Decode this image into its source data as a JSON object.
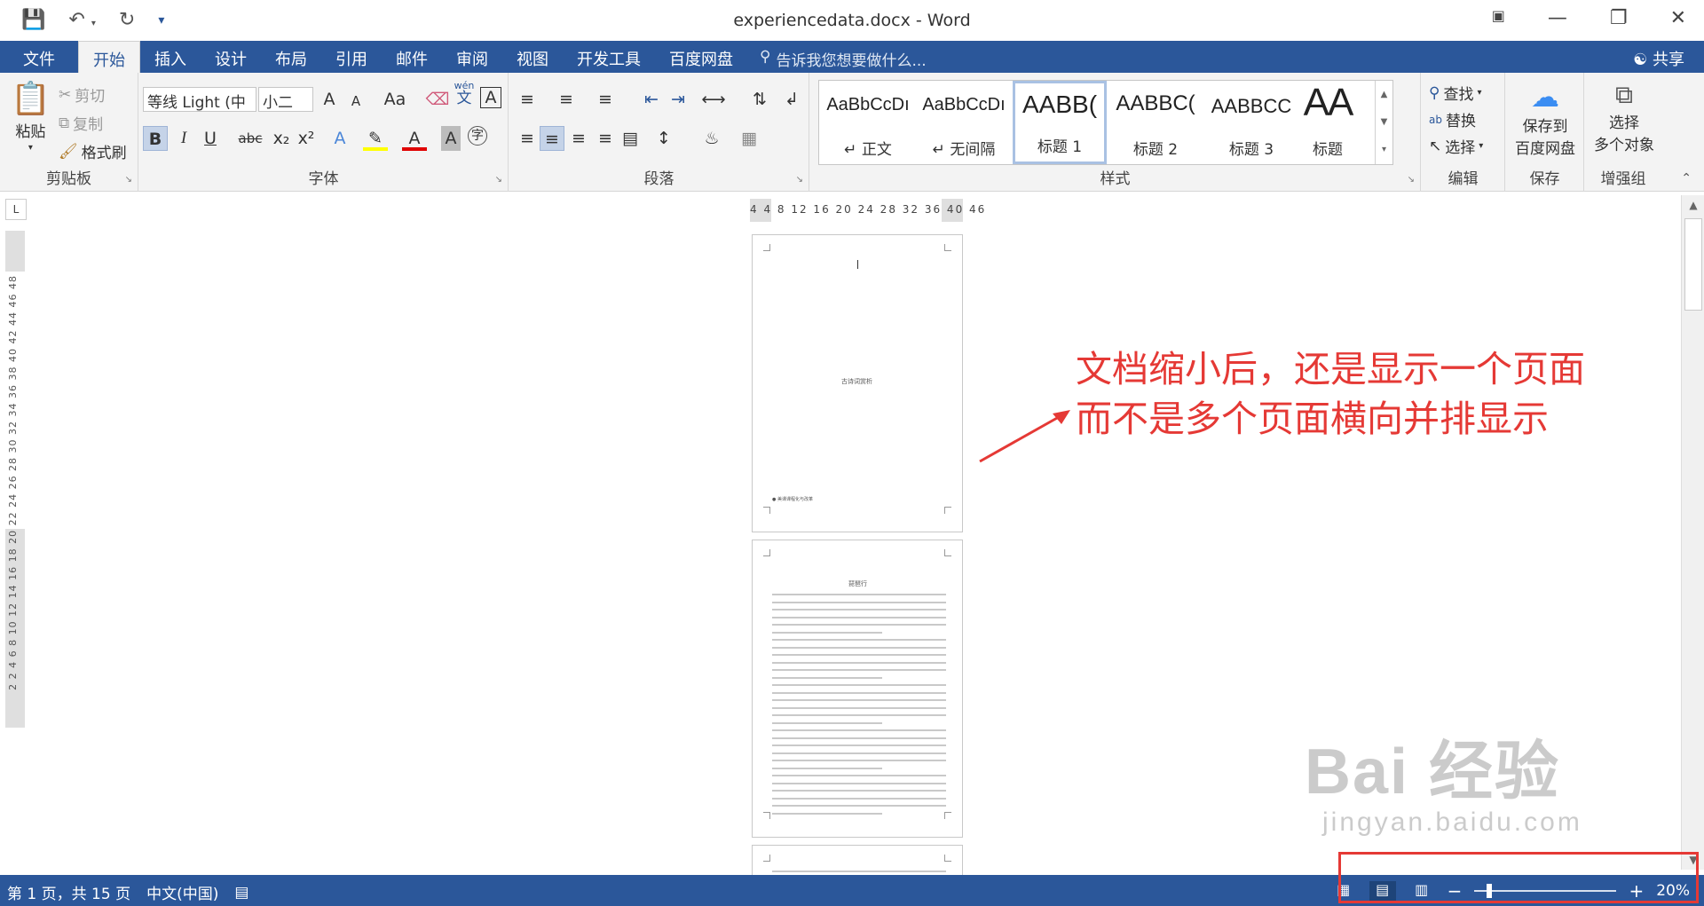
{
  "titlebar": {
    "title": "experiencedata.docx - Word",
    "save_icon": "save-icon",
    "undo_icon": "undo-icon",
    "redo_icon": "redo-icon",
    "customize_icon": "customize-qat-icon"
  },
  "tabs": {
    "file": "文件",
    "home": "开始",
    "insert": "插入",
    "design": "设计",
    "layout": "布局",
    "references": "引用",
    "mailings": "邮件",
    "review": "审阅",
    "view": "视图",
    "developer": "开发工具",
    "baidu": "百度网盘",
    "tell_me": "告诉我您想要做什么...",
    "share": "共享"
  },
  "clipboard": {
    "paste": "粘贴",
    "cut": "剪切",
    "copy": "复制",
    "format_painter": "格式刷",
    "label": "剪贴板"
  },
  "font": {
    "name": "等线 Light (中",
    "size": "小二",
    "label": "字体",
    "bold": "B",
    "italic": "I",
    "underline": "U",
    "strike": "abc",
    "sub": "x₂",
    "sup": "x²",
    "grow": "A",
    "shrink": "A",
    "case": "Aa",
    "phonetic": "wén",
    "phonetic_char": "文",
    "border_char": "A",
    "font_color_char": "A",
    "shading_char": "A",
    "encircle_char": "字"
  },
  "paragraph": {
    "label": "段落"
  },
  "styles": {
    "label": "样式",
    "items": [
      {
        "sample": "AaBbCcDı",
        "name": "↵ 正文"
      },
      {
        "sample": "AaBbCcDı",
        "name": "↵ 无间隔"
      },
      {
        "sample": "AABB(",
        "name": "标题 1"
      },
      {
        "sample": "AABBC(",
        "name": "标题 2"
      },
      {
        "sample": "AABBCC",
        "name": "标题 3"
      },
      {
        "sample": "AA",
        "name": "标题"
      }
    ]
  },
  "editing": {
    "find": "查找",
    "replace": "替换",
    "select": "选择",
    "label": "编辑"
  },
  "save_group": {
    "line1": "保存到",
    "line2": "百度网盘",
    "label": "保存"
  },
  "enhance_group": {
    "line1": "选择",
    "line2": "多个对象",
    "label": "增强组"
  },
  "ruler": {
    "horizontal": "4   4  8  12 16 20 24 28 32 36 40  46",
    "vertical": "2 2 4 6 8 10 12 14 16 18 20 22 24 26 28 30 32 34 36 38 40 42 44 46 48"
  },
  "pages": {
    "page1_center": "古诗词赏析",
    "page1_footer": "● 美课课程化与改革",
    "page2_title": "琵琶行"
  },
  "annotation": {
    "line1": "文档缩小后，还是显示一个页面",
    "line2": "而不是多个页面横向并排显示"
  },
  "watermark": {
    "brand": "Bai 经验",
    "url": "jingyan.baidu.com"
  },
  "status": {
    "page_info": "第 1 页，共 15 页",
    "language": "中文(中国)",
    "zoom_minus": "−",
    "zoom_plus": "+",
    "zoom_value": "20%",
    "zoom_fraction": 0.09
  },
  "colors": {
    "accent": "#2b579a",
    "annotation": "#e53935"
  }
}
